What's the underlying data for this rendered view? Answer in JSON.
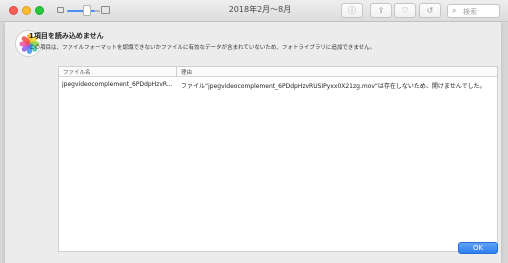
{
  "window": {
    "title": "2018年2月〜8月",
    "search_placeholder": "検索"
  },
  "toolbar": {
    "info_icon": "info-icon",
    "share_icon": "share-icon",
    "heart_icon": "heart-icon",
    "rotate_icon": "rotate-icon",
    "search_icon": "search-icon"
  },
  "dialog": {
    "title": "1項目を読み込めません",
    "message": "この項目は、ファイルフォーマットを認識できないかファイルに有効なデータが含まれていないため、フォトライブラリに追加できません。",
    "table": {
      "columns": [
        "ファイル名",
        "理由"
      ],
      "rows": [
        {
          "file": "jpegvideocomplement_6PDdpHzvR...",
          "reason": "ファイル“jpegvideocomplement_6PDdpHzvRUSIPyxx0X21zg.mov”は存在しないため、開けませんでした。"
        }
      ]
    },
    "ok_label": "OK"
  },
  "colors": {
    "accent": "#2f7ff0",
    "close": "#fc5f57",
    "minimize": "#fdbc2e",
    "zoom": "#28c83f"
  }
}
